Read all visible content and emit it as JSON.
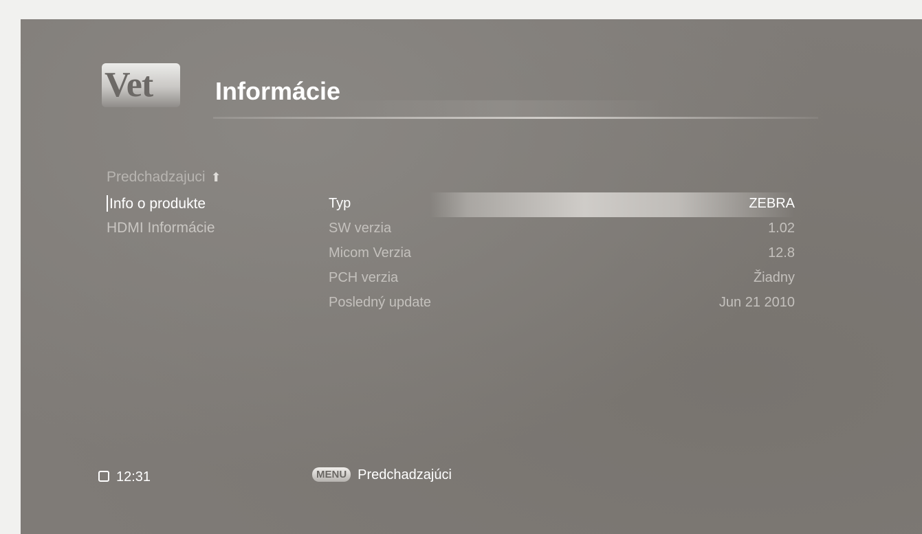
{
  "header": {
    "logo_text": "Vet",
    "title": "Informácie"
  },
  "sidebar": {
    "items": [
      {
        "label": "Predchadzajuci",
        "icon": "arrow-up-icon"
      },
      {
        "label": "Info o produkte",
        "selected": true
      },
      {
        "label": "HDMI Informácie"
      }
    ]
  },
  "info": {
    "rows": [
      {
        "label": "Typ",
        "value": "ZEBRA",
        "selected": true
      },
      {
        "label": "SW verzia",
        "value": "1.02"
      },
      {
        "label": "Micom Verzia",
        "value": "12.8"
      },
      {
        "label": "PCH verzia",
        "value": "Žiadny"
      },
      {
        "label": "Posledný update",
        "value": "Jun 21 2010"
      }
    ]
  },
  "footer": {
    "clock_icon": "clock-icon",
    "time": "12:31",
    "menu_key": "MENU",
    "menu_action": "Predchadzajúci"
  }
}
